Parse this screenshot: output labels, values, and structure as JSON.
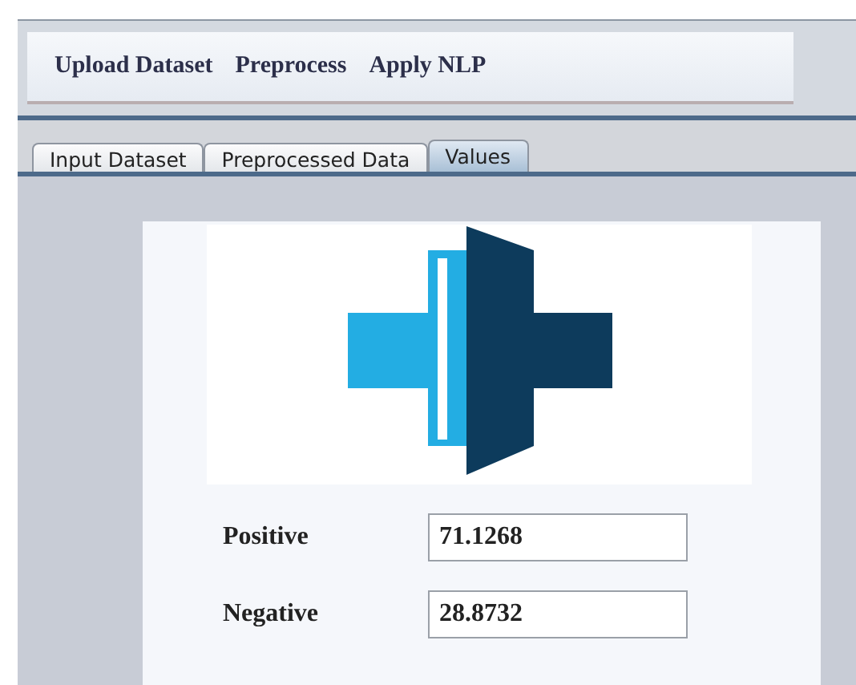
{
  "menu": [
    {
      "label": "Upload Dataset"
    },
    {
      "label": "Preprocess"
    },
    {
      "label": "Apply NLP"
    }
  ],
  "tabs": [
    {
      "label": "Input Dataset",
      "selected": false
    },
    {
      "label": "Preprocessed Data",
      "selected": false
    },
    {
      "label": "Values",
      "selected": true
    }
  ],
  "results": [
    {
      "label": "Positive",
      "value": "71.1268"
    },
    {
      "label": "Negative",
      "value": "28.8732"
    }
  ]
}
